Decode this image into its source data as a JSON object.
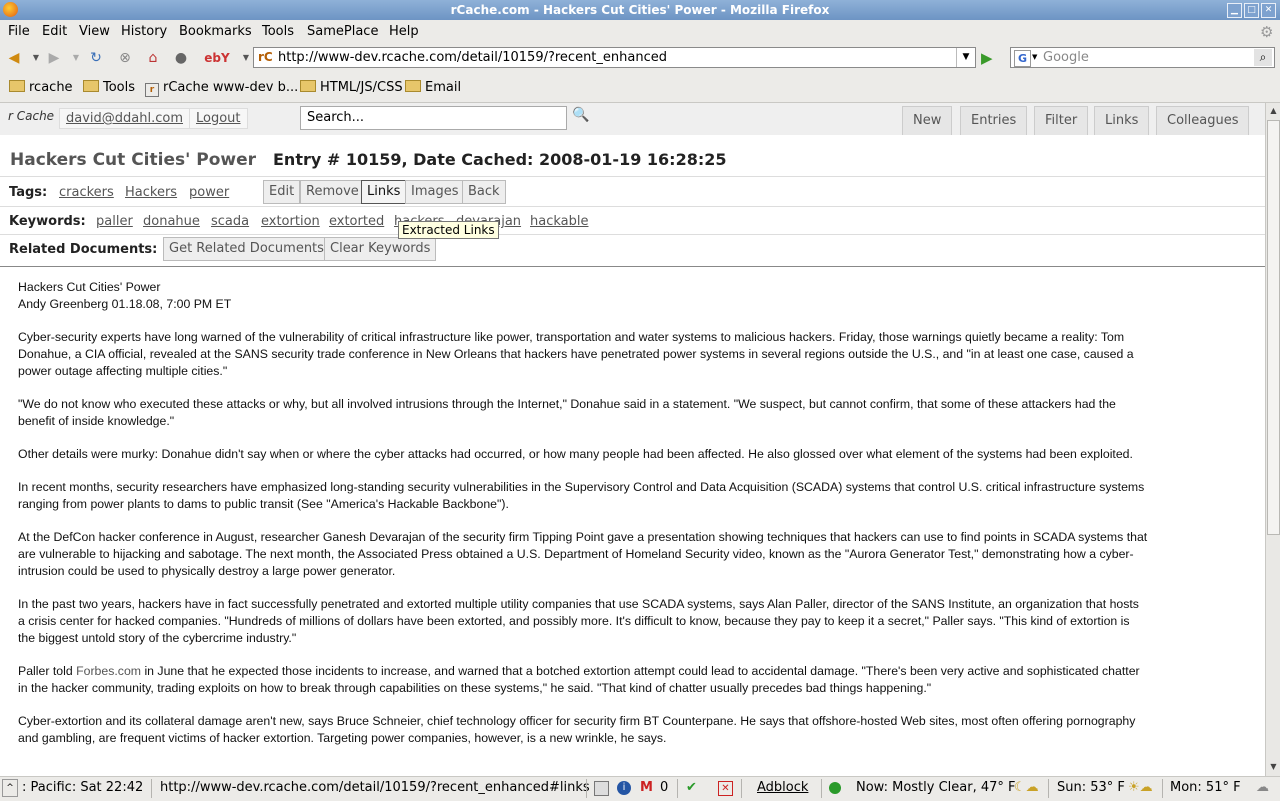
{
  "window": {
    "title": "rCache.com - Hackers Cut Cities' Power - Mozilla Firefox"
  },
  "menu": [
    "File",
    "Edit",
    "View",
    "History",
    "Bookmarks",
    "Tools",
    "SamePlace",
    "Help"
  ],
  "urlbar": {
    "url": "http://www-dev.rcache.com/detail/10159/?recent_enhanced",
    "favicon": "rC"
  },
  "searchbar": {
    "placeholder": "Google",
    "engine": "G"
  },
  "bookmarks": [
    "rcache",
    "Tools",
    "rCache www-dev b...",
    "HTML/JS/CSS",
    "Email"
  ],
  "app": {
    "logo": "r Cache",
    "user": "david@ddahl.com",
    "logout": "Logout",
    "search_placeholder": "Search...",
    "tabs": [
      "New",
      "Entries",
      "Filter",
      "Links",
      "Colleagues"
    ]
  },
  "entry": {
    "title": "Hackers Cut Cities' Power",
    "info": "Entry # 10159, Date Cached: 2008-01-19 16:28:25",
    "tags_label": "Tags:",
    "tags": [
      "crackers",
      "Hackers",
      "power"
    ],
    "actions": [
      "Edit",
      "Remove",
      "Links",
      "Images",
      "Back"
    ],
    "keywords_label": "Keywords:",
    "keywords": [
      "paller",
      "donahue",
      "scada",
      "extortion",
      "extorted",
      "hackers",
      "devarajan",
      "hackable"
    ],
    "tooltip": "Extracted Links",
    "related_label": "Related Documents:",
    "related_buttons": [
      "Get Related Documents",
      "Clear Keywords"
    ]
  },
  "article": {
    "headline": "Hackers Cut Cities' Power",
    "byline": "Andy Greenberg 01.18.08, 7:00 PM ET",
    "paragraphs": [
      "Cyber-security experts have long warned of the vulnerability of critical infrastructure like power, transportation and water systems to malicious hackers. Friday, those warnings quietly became a reality: Tom Donahue, a CIA official, revealed at the SANS security trade conference in New Orleans that hackers have penetrated power systems in several regions outside the U.S., and \"in at least one case, caused a power outage affecting multiple cities.\"",
      "\"We do not know who executed these attacks or why, but all involved intrusions through the Internet,\" Donahue said in a statement. \"We suspect, but cannot confirm, that some of these attackers had the benefit of inside knowledge.\"",
      "Other details were murky: Donahue didn't say when or where the cyber attacks had occurred, or how many people had been affected. He also glossed over what element of the systems had been exploited.",
      "In recent months, security researchers have emphasized long-standing security vulnerabilities in the Supervisory Control and Data Acquisition (SCADA) systems that control U.S. critical infrastructure systems ranging from power plants to dams to public transit (See \"America's Hackable Backbone\").",
      "At the DefCon hacker conference in August, researcher Ganesh Devarajan of the security firm Tipping Point gave a presentation showing techniques that hackers can use to find points in SCADA systems that are vulnerable to hijacking and sabotage. The next month, the Associated Press obtained a U.S. Department of Homeland Security video, known as the \"Aurora Generator Test,\" demonstrating how a cyber-intrusion could be used to physically destroy a large power generator.",
      "In the past two years, hackers have in fact successfully penetrated and extorted multiple utility companies that use SCADA systems, says Alan Paller, director of the SANS Institute, an organization that hosts a crisis center for hacked companies. \"Hundreds of millions of dollars have been extorted, and possibly more. It's difficult to know, because they pay to keep it a secret,\" Paller says. \"This kind of extortion is the biggest untold story of the cybercrime industry.\""
    ],
    "p7_before": "Paller told ",
    "p7_link": "Forbes.com",
    "p7_after": " in June that he expected those incidents to increase, and warned that a botched extortion attempt could lead to accidental damage. \"There's been very active and sophisticated chatter in the hacker community, trading exploits on how to break through capabilities on these systems,\" he said. \"That kind of chatter usually precedes bad things happening.\"",
    "p8": "Cyber-extortion and its collateral damage aren't new, says Bruce Schneier, chief technology officer for security firm BT Counterpane. He says that offshore-hosted Web sites, most often offering pornography and gambling, are frequent victims of hacker extortion. Targeting power companies, however, is a new wrinkle, he says."
  },
  "status": {
    "clock": ": Pacific: Sat 22:42",
    "link": "http://www-dev.rcache.com/detail/10159/?recent_enhanced#links",
    "gmail_count": "0",
    "adblock": "Adblock",
    "weather_now": "Now: Mostly Clear, 47° F",
    "weather_sun": "Sun: 53° F",
    "weather_mon": "Mon: 51° F"
  }
}
